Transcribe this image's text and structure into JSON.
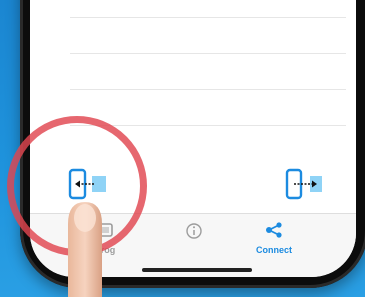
{
  "toolbar": {
    "tabs": [
      {
        "label": "Prog",
        "icon": "program-icon"
      },
      {
        "label": "",
        "icon": "info-icon"
      },
      {
        "label": "Connect",
        "icon": "share-connect-icon",
        "active": true
      }
    ]
  },
  "colors": {
    "accent": "#1c8be0",
    "inactive": "#9c9c9c",
    "highlight_ring": "#e0464f",
    "background": "#1f8fd6"
  },
  "icons": {
    "left_button": "transfer-left-icon",
    "right_button": "transfer-right-icon",
    "home_indicator": "home-indicator"
  }
}
